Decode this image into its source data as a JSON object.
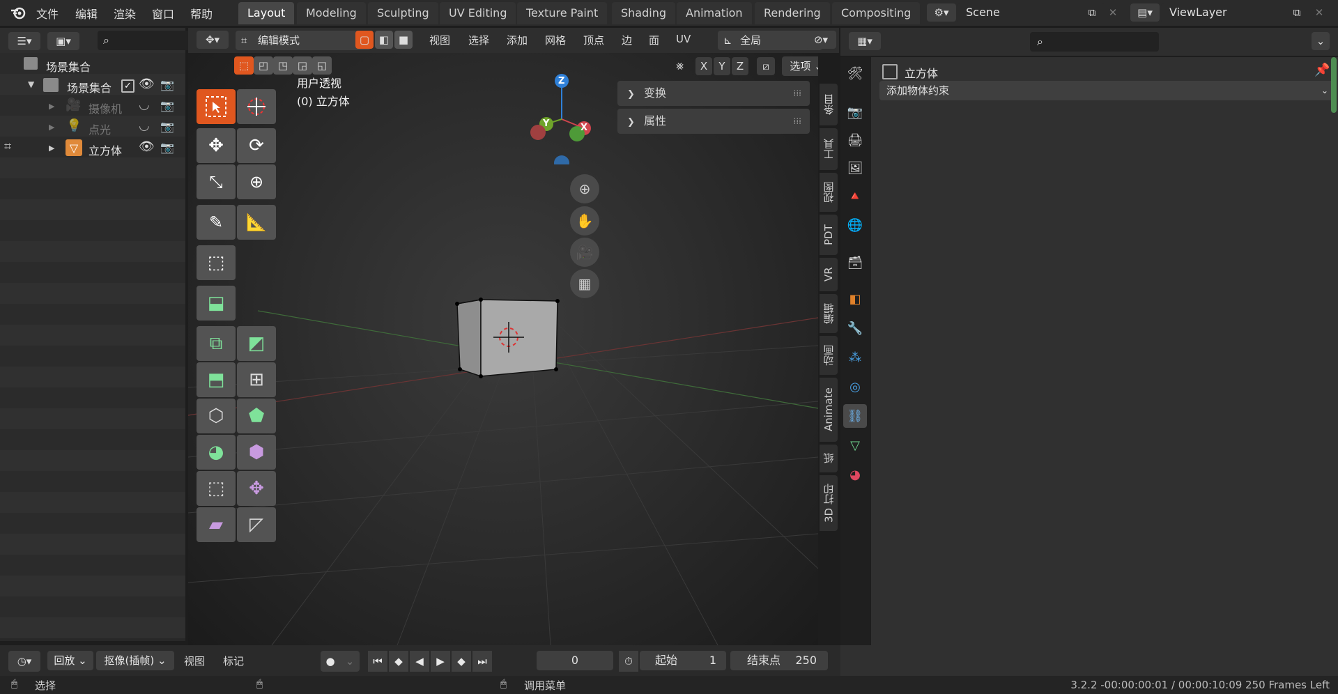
{
  "topbar": {
    "menus": [
      "文件",
      "编辑",
      "渲染",
      "窗口",
      "帮助"
    ],
    "workspaces": [
      "Layout",
      "Modeling",
      "Sculpting",
      "UV Editing",
      "Texture Paint",
      "Shading",
      "Animation",
      "Rendering",
      "Compositing"
    ],
    "active_workspace": "Layout",
    "scene_name": "Scene",
    "view_layer": "ViewLayer"
  },
  "outliner": {
    "root": "场景集合",
    "collection": "场景集合",
    "items": [
      {
        "label": "摄像机",
        "icon": "camera-icon",
        "visible": false
      },
      {
        "label": "点光",
        "icon": "light-icon",
        "visible": false
      },
      {
        "label": "立方体",
        "icon": "mesh-icon",
        "visible": true
      }
    ]
  },
  "viewport_header": {
    "mode": "编辑模式",
    "menus": [
      "视图",
      "选择",
      "添加",
      "网格",
      "顶点",
      "边",
      "面",
      "UV"
    ],
    "orientation": "全局",
    "options_label": "选项",
    "axes": [
      "X",
      "Y",
      "Z"
    ]
  },
  "viewport": {
    "view_name": "用户透视",
    "object_label": "(0) 立方体",
    "gizmo_labels": {
      "z": "Z",
      "y": "Y",
      "x": "X"
    },
    "panels": [
      "变换",
      "属性"
    ],
    "side_tabs": [
      "条目",
      "工具",
      "视图",
      "PDT",
      "VR",
      "编辑",
      "动画",
      "Animate",
      "纸",
      "3D 打印"
    ]
  },
  "properties": {
    "object_name": "立方体",
    "add_constraint": "添加物体约束",
    "tabs": [
      "tool-icon",
      "render-icon",
      "output-icon",
      "view-layer-icon",
      "scene-icon",
      "world-icon",
      "collection-icon",
      "object-icon",
      "modifier-icon",
      "particles-icon",
      "physics-icon",
      "constraint-icon",
      "data-icon",
      "material-icon"
    ]
  },
  "timeline": {
    "playback": "回放",
    "keying": "抠像(插帧)",
    "view": "视图",
    "marker": "标记",
    "current_frame": "0",
    "start_label": "起始",
    "start_value": "1",
    "end_label": "结束点",
    "end_value": "250"
  },
  "statusbar": {
    "left": "选择",
    "center": "调用菜单",
    "right": "3.2.2  -00:00:00:01 / 00:00:10:09  250 Frames Left"
  },
  "colors": {
    "accent": "#e0571f",
    "selected_tool": "#e0571f",
    "axis_x": "#d0454e",
    "axis_y": "#6fa32a",
    "axis_z": "#2f80d8"
  }
}
